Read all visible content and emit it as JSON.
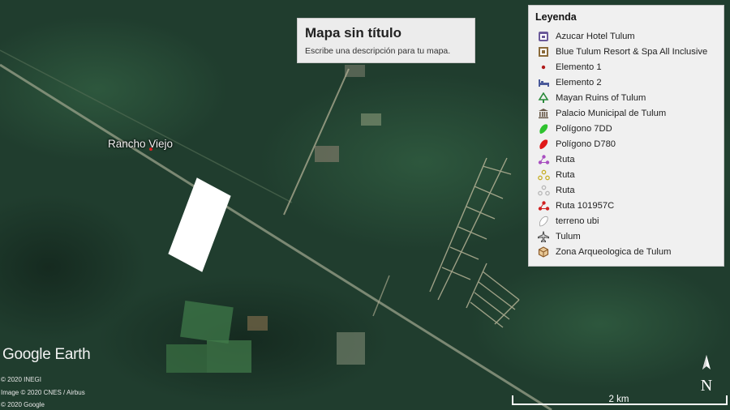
{
  "map": {
    "title": "Mapa sin título",
    "description": "Escribe una descripción para tu mapa.",
    "place_label": "Rancho Viejo",
    "provider_logo": "Google Earth",
    "credits": [
      "© 2020 INEGI",
      "Image © 2020 CNES / Airbus",
      "© 2020 Google"
    ],
    "scale_label": "2 km",
    "north_label": "N"
  },
  "legend": {
    "title": "Leyenda",
    "items": [
      {
        "label": "Azucar Hotel Tulum",
        "icon": "hotel-icon",
        "color": "#6b5a9a"
      },
      {
        "label": "Blue Tulum Resort & Spa All Inclusive",
        "icon": "resort-icon",
        "color": "#8a6a3a"
      },
      {
        "label": "Elemento 1",
        "icon": "dot-icon",
        "color": "#b01a1a"
      },
      {
        "label": "Elemento 2",
        "icon": "bed-icon",
        "color": "#4a5a9a"
      },
      {
        "label": "Mayan Ruins of Tulum",
        "icon": "tree-icon",
        "color": "#2a8a3a"
      },
      {
        "label": "Palacio Municipal de Tulum",
        "icon": "government-icon",
        "color": "#6a5a4a"
      },
      {
        "label": "Polígono 7DD",
        "icon": "polygon-icon",
        "color": "#2ec22e"
      },
      {
        "label": "Polígono D780",
        "icon": "polygon-icon",
        "color": "#e01818"
      },
      {
        "label": "Ruta",
        "icon": "route-icon",
        "color": "#a84fc0"
      },
      {
        "label": "Ruta",
        "icon": "route-icon",
        "color": "#c8b02a"
      },
      {
        "label": "Ruta",
        "icon": "route-icon",
        "color": "#b8b8b8"
      },
      {
        "label": "Ruta 101957C",
        "icon": "route-icon",
        "color": "#d02020"
      },
      {
        "label": "terreno ubi",
        "icon": "polygon-icon",
        "color": "#ffffff"
      },
      {
        "label": "Tulum",
        "icon": "airport-icon",
        "color": "#444444"
      },
      {
        "label": "Zona Arqueologica de Tulum",
        "icon": "ruins-icon",
        "color": "#8a5a2a"
      }
    ]
  }
}
